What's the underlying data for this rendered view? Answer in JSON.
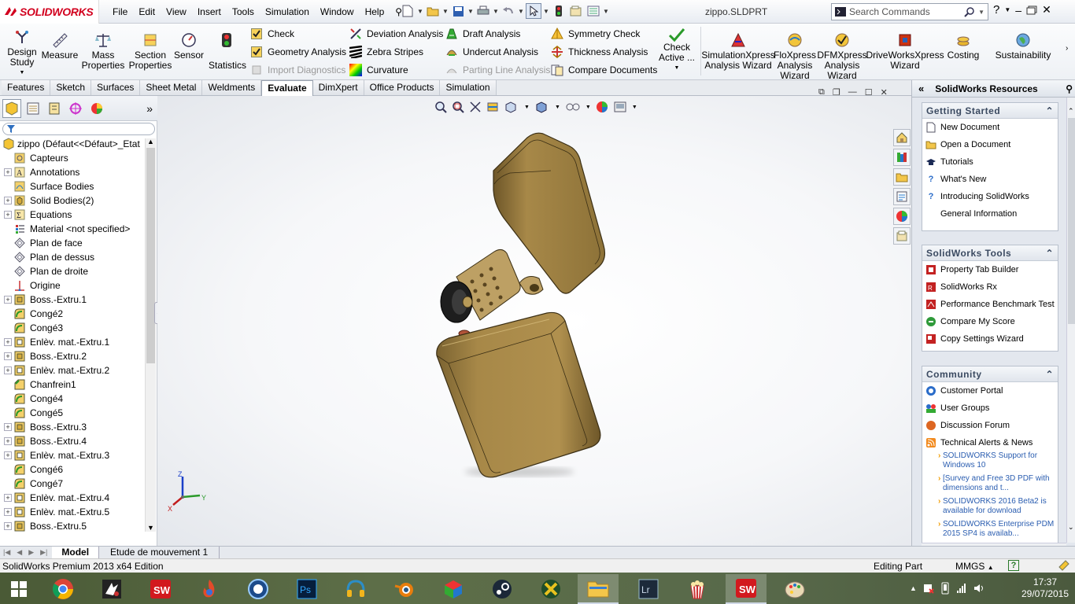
{
  "app": {
    "logo_text": "SOLIDWORKS",
    "document_title": "zippo.SLDPRT"
  },
  "menu": [
    "File",
    "Edit",
    "View",
    "Insert",
    "Tools",
    "Simulation",
    "Window",
    "Help"
  ],
  "search": {
    "placeholder": "Search Commands"
  },
  "command_manager": {
    "design_study": "Design\nStudy",
    "measure": "Measure",
    "mass_properties": "Mass\nProperties",
    "section_properties": "Section\nProperties",
    "sensor": "Sensor",
    "statistics": "Statistics",
    "check": "Check",
    "geometry_analysis": "Geometry Analysis",
    "import_diagnostics": "Import Diagnostics",
    "deviation_analysis": "Deviation Analysis",
    "zebra_stripes": "Zebra Stripes",
    "curvature": "Curvature",
    "draft_analysis": "Draft Analysis",
    "undercut_analysis": "Undercut Analysis",
    "parting_line_analysis": "Parting Line Analysis",
    "symmetry_check": "Symmetry Check",
    "thickness_analysis": "Thickness Analysis",
    "compare_documents": "Compare Documents",
    "check_active": "Check\nActive ...",
    "simulationxpress": "SimulationXpress\nAnalysis Wizard",
    "floxpress": "FloXpress\nAnalysis\nWizard",
    "dfmxpress": "DFMXpress\nAnalysis\nWizard",
    "driveworksxpress": "DriveWorksXpress\nWizard",
    "costing": "Costing",
    "sustainability": "Sustainability"
  },
  "tabs": [
    "Features",
    "Sketch",
    "Surfaces",
    "Sheet Metal",
    "Weldments",
    "Evaluate",
    "DimXpert",
    "Office Products",
    "Simulation"
  ],
  "active_tab": "Evaluate",
  "tree": {
    "root": "zippo  (Défaut<<Défaut>_Etat",
    "items": [
      {
        "label": "Capteurs",
        "icon": "sensor-folder-icon",
        "exp": false
      },
      {
        "label": "Annotations",
        "icon": "annotations-icon",
        "exp": true
      },
      {
        "label": "Surface Bodies",
        "icon": "surface-bodies-icon",
        "exp": false
      },
      {
        "label": "Solid Bodies(2)",
        "icon": "solid-bodies-icon",
        "exp": true
      },
      {
        "label": "Equations",
        "icon": "equations-icon",
        "exp": true
      },
      {
        "label": "Material <not specified>",
        "icon": "material-icon",
        "exp": false
      },
      {
        "label": "Plan de face",
        "icon": "plane-icon",
        "exp": false
      },
      {
        "label": "Plan de dessus",
        "icon": "plane-icon",
        "exp": false
      },
      {
        "label": "Plan de droite",
        "icon": "plane-icon",
        "exp": false
      },
      {
        "label": "Origine",
        "icon": "origin-icon",
        "exp": false
      },
      {
        "label": "Boss.-Extru.1",
        "icon": "extrude-icon",
        "exp": true
      },
      {
        "label": "Congé2",
        "icon": "fillet-icon",
        "exp": false
      },
      {
        "label": "Congé3",
        "icon": "fillet-icon",
        "exp": false
      },
      {
        "label": "Enlèv. mat.-Extru.1",
        "icon": "cut-extrude-icon",
        "exp": true
      },
      {
        "label": "Boss.-Extru.2",
        "icon": "extrude-icon",
        "exp": true
      },
      {
        "label": "Enlèv. mat.-Extru.2",
        "icon": "cut-extrude-icon",
        "exp": true
      },
      {
        "label": "Chanfrein1",
        "icon": "chamfer-icon",
        "exp": false
      },
      {
        "label": "Congé4",
        "icon": "fillet-icon",
        "exp": false
      },
      {
        "label": "Congé5",
        "icon": "fillet-icon",
        "exp": false
      },
      {
        "label": "Boss.-Extru.3",
        "icon": "extrude-icon",
        "exp": true
      },
      {
        "label": "Boss.-Extru.4",
        "icon": "extrude-icon",
        "exp": true
      },
      {
        "label": "Enlèv. mat.-Extru.3",
        "icon": "cut-extrude-icon",
        "exp": true
      },
      {
        "label": "Congé6",
        "icon": "fillet-icon",
        "exp": false
      },
      {
        "label": "Congé7",
        "icon": "fillet-icon",
        "exp": false
      },
      {
        "label": "Enlèv. mat.-Extru.4",
        "icon": "cut-extrude-icon",
        "exp": true
      },
      {
        "label": "Enlèv. mat.-Extru.5",
        "icon": "cut-extrude-icon",
        "exp": true
      },
      {
        "label": "Boss.-Extru.5",
        "icon": "extrude-icon",
        "exp": true
      }
    ]
  },
  "bottom_tabs": [
    "Model",
    "Etude de mouvement 1"
  ],
  "status": {
    "edition": "SolidWorks Premium 2013 x64 Edition",
    "mode": "Editing Part",
    "units": "MMGS"
  },
  "triad": {
    "x": "X",
    "y": "Y",
    "z": "Z"
  },
  "task_pane": {
    "title": "SolidWorks Resources",
    "getting_started": {
      "title": "Getting Started",
      "items": [
        "New Document",
        "Open a Document",
        "Tutorials",
        "What's New",
        "Introducing SolidWorks",
        "General Information"
      ]
    },
    "tools": {
      "title": "SolidWorks Tools",
      "items": [
        "Property Tab Builder",
        "SolidWorks Rx",
        "Performance Benchmark Test",
        "Compare My Score",
        "Copy Settings Wizard"
      ]
    },
    "community": {
      "title": "Community",
      "items": [
        "Customer Portal",
        "User Groups",
        "Discussion Forum",
        "Technical Alerts & News"
      ]
    },
    "news": [
      "SOLIDWORKS Support for Windows 10",
      "[Survey and Free 3D PDF with dimensions and t...",
      "SOLIDWORKS 2016 Beta2 is available for download",
      "SOLIDWORKS Enterprise PDM 2015 SP4 is availab..."
    ]
  },
  "taskbar": {
    "time": "17:37",
    "date": "29/07/2015"
  },
  "colors": {
    "brand_red": "#d2001e",
    "part": "#a78848",
    "taskbar": "#56674a"
  }
}
